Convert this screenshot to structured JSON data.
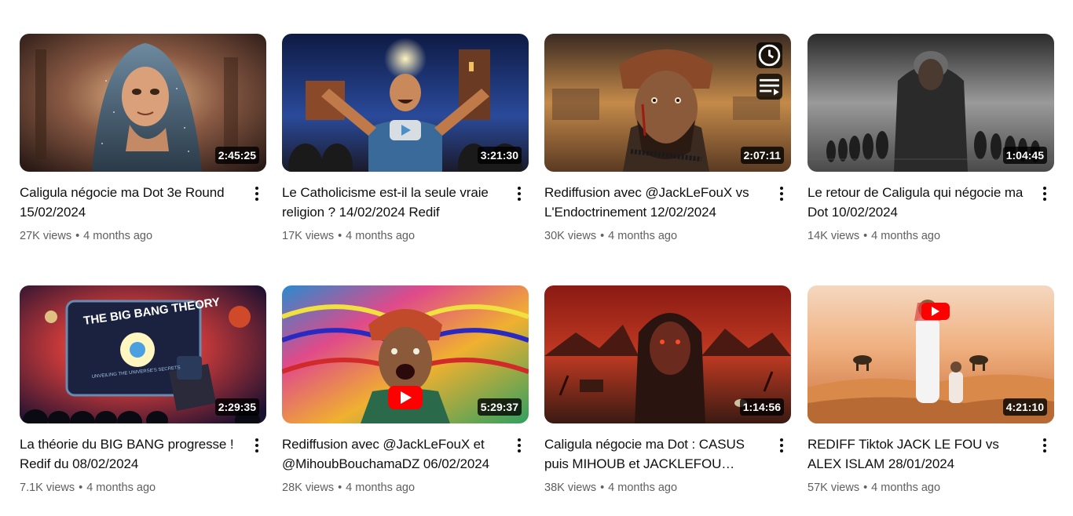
{
  "videos": [
    {
      "title": "Caligula négocie ma Dot 3e Round 15/02/2024",
      "views": "27K views",
      "age": "4 months ago",
      "duration": "2:45:25",
      "accent": "#3a5a72"
    },
    {
      "title": "Le Catholicisme est-il la seule vraie religion ? 14/02/2024 Redif",
      "views": "17K views",
      "age": "4 months ago",
      "duration": "3:21:30",
      "accent": "#1f3a7a"
    },
    {
      "title": "Rediffusion avec @JackLeFouX vs L'Endoctrinement 12/02/2024",
      "views": "30K views",
      "age": "4 months ago",
      "duration": "2:07:11",
      "accent": "#8a5a2a"
    },
    {
      "title": "Le retour de Caligula qui négocie ma Dot 10/02/2024",
      "views": "14K views",
      "age": "4 months ago",
      "duration": "1:04:45",
      "accent": "#5a5a5a"
    },
    {
      "title": "La théorie du BIG BANG progresse ! Redif du 08/02/2024",
      "views": "7.1K views",
      "age": "4 months ago",
      "duration": "2:29:35",
      "accent": "#1e2a5a"
    },
    {
      "title": "Rediffusion avec @JackLeFouX et @MihoubBouchamaDZ 06/02/2024",
      "views": "28K views",
      "age": "4 months ago",
      "duration": "5:29:37",
      "accent": "#b02a6a"
    },
    {
      "title": "Caligula négocie ma Dot : CASUS puis MIHOUB et JACKLEFOU…",
      "views": "38K views",
      "age": "4 months ago",
      "duration": "1:14:56",
      "accent": "#6a1a14"
    },
    {
      "title": "REDIFF Tiktok JACK LE FOU vs ALEX ISLAM 28/01/2024",
      "views": "57K views",
      "age": "4 months ago",
      "duration": "4:21:10",
      "accent": "#d98a4a"
    }
  ],
  "thumb_text": {
    "big_bang_title": "THE BIG BANG THEORY",
    "big_bang_subtitle": "UNVEILING THE UNIVERSE'S SECRETS"
  },
  "icons": {
    "watch_later": "clock-icon",
    "add_to_queue": "queue-icon",
    "menu": "more-vert-icon",
    "play": "play-icon"
  }
}
